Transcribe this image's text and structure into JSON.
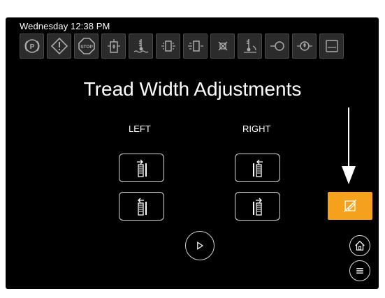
{
  "status": {
    "clock": "Wednesday 12:38 PM"
  },
  "indicators": [
    {
      "name": "parking-brake-icon",
      "glyph": "(P)"
    },
    {
      "name": "warning-icon",
      "glyph": "!"
    },
    {
      "name": "stop-icon",
      "glyph": "STOP"
    },
    {
      "name": "fuel-filter-icon"
    },
    {
      "name": "coolant-temp-icon"
    },
    {
      "name": "hydraulic-filter-icon"
    },
    {
      "name": "hydraulic-filter-2-icon"
    },
    {
      "name": "transmission-filter-icon"
    },
    {
      "name": "hydraulic-oil-temp-icon"
    },
    {
      "name": "air-filter-icon"
    },
    {
      "name": "engine-oil-pressure-icon"
    },
    {
      "name": "fuel-level-icon"
    }
  ],
  "page": {
    "title": "Tread Width Adjustments",
    "left_label": "LEFT",
    "right_label": "RIGHT"
  },
  "colors": {
    "accent": "#f6a11b",
    "background": "#000000",
    "indicator_bg": "#2b2b2b"
  }
}
